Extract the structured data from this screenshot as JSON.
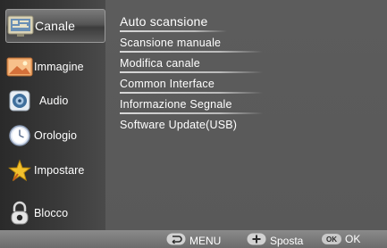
{
  "sidebar": {
    "items": [
      {
        "label": "Canale",
        "icon": "channel-tv-icon",
        "active": true
      },
      {
        "label": "Immagine",
        "icon": "picture-icon",
        "active": false
      },
      {
        "label": "Audio",
        "icon": "speaker-icon",
        "active": false
      },
      {
        "label": "Orologio",
        "icon": "clock-icon",
        "active": false
      },
      {
        "label": "Impostare",
        "icon": "star-icon",
        "active": false
      },
      {
        "label": "Blocco",
        "icon": "lock-icon",
        "active": false
      }
    ]
  },
  "menu": {
    "items": [
      {
        "label": "Auto scansione",
        "active": true
      },
      {
        "label": "Scansione manuale",
        "active": false
      },
      {
        "label": "Modifica canale",
        "active": false
      },
      {
        "label": "Common Interface",
        "active": false
      },
      {
        "label": "Informazione Segnale",
        "active": false
      },
      {
        "label": "Software Update(USB)",
        "active": false
      }
    ]
  },
  "footer": {
    "menu_label": "MENU",
    "move_label": "Sposta",
    "ok_badge": "OK",
    "ok_label": "OK"
  },
  "colors": {
    "sidebar_bg": "#3b3b3b",
    "menu_bg": "#5c5c5c",
    "footer_bg": "#7a7a7a",
    "text": "#ffffff"
  }
}
